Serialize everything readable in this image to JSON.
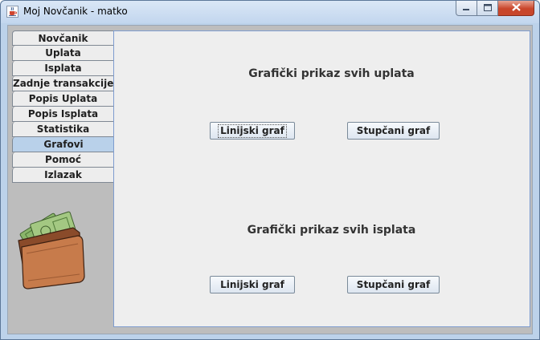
{
  "window": {
    "title": "Moj Novčanik - matko",
    "icon": "java-cup-icon"
  },
  "controls": {
    "minimize_icon": "minimize-icon",
    "maximize_icon": "maximize-icon",
    "close_icon": "close-icon"
  },
  "sidebar": {
    "items": [
      {
        "label": "Novčanik"
      },
      {
        "label": "Uplata"
      },
      {
        "label": "Isplata"
      },
      {
        "label": "Zadnje transakcije"
      },
      {
        "label": "Popis Uplata"
      },
      {
        "label": "Popis Isplata"
      },
      {
        "label": "Statistika"
      },
      {
        "label": "Grafovi"
      },
      {
        "label": "Pomoć"
      },
      {
        "label": "Izlazak"
      }
    ],
    "active_index": 7,
    "image": "wallet-icon"
  },
  "main": {
    "uplate_heading": "Grafički prikaz svih uplata",
    "uplate_line_button": "Linijski graf",
    "uplate_bar_button": "Stupčani graf",
    "isplate_heading": "Grafički prikaz svih isplata",
    "isplate_line_button": "Linijski graf",
    "isplate_bar_button": "Stupčani graf"
  },
  "colors": {
    "active_tab": "#b9d1ea",
    "panel_border": "#7e9ccf",
    "close_button": "#c7472c"
  }
}
